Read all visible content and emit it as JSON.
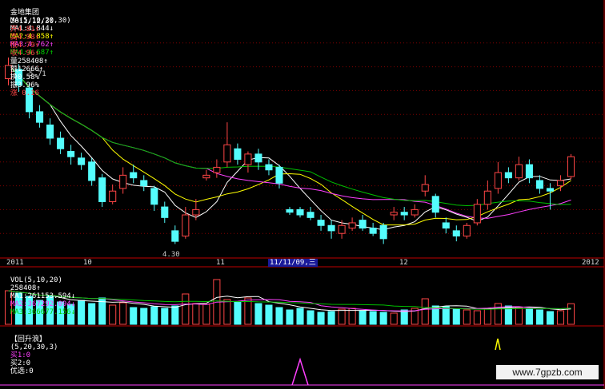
{
  "header": {
    "stock_name": "金地集团",
    "ma_label": "MA(5,10,20,30)",
    "ma1": "MA1:4.844↓",
    "ma2": "MA2:4.858↑",
    "ma3": "MA3:4.762↑",
    "ma4": "MA4:4.687↑",
    "date": "2011/12/30",
    "open": "开4.81↑",
    "high": "高4.98↑",
    "low": "低4.79↑",
    "close": "收4.96↑",
    "volume": "量258408↑",
    "amount": "额12666↑",
    "turnover": "换0.58%",
    "amplitude": "振3.96%",
    "change": "涨 0.16"
  },
  "price_annotations": {
    "high_marker": "5.71",
    "low_marker": "4.30"
  },
  "date_axis": {
    "labels": [
      "2011",
      "10",
      "11",
      "12",
      "2012"
    ],
    "cursor_label": "11/11/09,三"
  },
  "volume_header": {
    "label": "VOL(5,10,20)",
    "value": "258408↑",
    "ma1": "MA1:261153.594↓",
    "ma2": "MA2:367292.094↓",
    "ma3": "MA3:366677.156↓"
  },
  "indicator_header": {
    "name": "【回升浪】",
    "params": "(5,20,30,3)",
    "buy1": "买1:0",
    "buy2": "买2:0",
    "pick": "优选:0"
  },
  "watermark": "www.7gpzb.com",
  "colors": {
    "up": "#ff4646",
    "down": "#54fcfc",
    "ma1": "#ffffff",
    "ma2": "#ffff00",
    "ma3": "#ff40ff",
    "ma4": "#00c000",
    "grid": "#800000",
    "axis": "#c00000"
  },
  "chart_data": {
    "type": "candlestick",
    "title": "金地集团",
    "x_range": [
      "2011-08",
      "2012-01"
    ],
    "y_range": [
      4.2,
      6.0
    ],
    "grid": true,
    "candles": [
      {
        "o": 5.55,
        "c": 5.65,
        "h": 5.71,
        "l": 5.5
      },
      {
        "o": 5.62,
        "c": 5.5,
        "h": 5.66,
        "l": 5.45
      },
      {
        "o": 5.48,
        "c": 5.3,
        "h": 5.52,
        "l": 5.25
      },
      {
        "o": 5.3,
        "c": 5.22,
        "h": 5.35,
        "l": 5.18
      },
      {
        "o": 5.2,
        "c": 5.1,
        "h": 5.25,
        "l": 5.05
      },
      {
        "o": 5.1,
        "c": 5.02,
        "h": 5.15,
        "l": 4.98
      },
      {
        "o": 5.0,
        "c": 4.96,
        "h": 5.05,
        "l": 4.9
      },
      {
        "o": 4.95,
        "c": 4.9,
        "h": 4.99,
        "l": 4.86
      },
      {
        "o": 4.92,
        "c": 4.78,
        "h": 4.95,
        "l": 4.74
      },
      {
        "o": 4.8,
        "c": 4.62,
        "h": 4.83,
        "l": 4.58
      },
      {
        "o": 4.62,
        "c": 4.7,
        "h": 4.75,
        "l": 4.6
      },
      {
        "o": 4.72,
        "c": 4.82,
        "h": 4.88,
        "l": 4.68
      },
      {
        "o": 4.84,
        "c": 4.8,
        "h": 4.9,
        "l": 4.76
      },
      {
        "o": 4.78,
        "c": 4.74,
        "h": 4.82,
        "l": 4.7
      },
      {
        "o": 4.72,
        "c": 4.6,
        "h": 4.74,
        "l": 4.55
      },
      {
        "o": 4.58,
        "c": 4.5,
        "h": 4.62,
        "l": 4.46
      },
      {
        "o": 4.4,
        "c": 4.32,
        "h": 4.44,
        "l": 4.3
      },
      {
        "o": 4.36,
        "c": 4.52,
        "h": 4.58,
        "l": 4.34
      },
      {
        "o": 4.52,
        "c": 4.56,
        "h": 4.64,
        "l": 4.48
      },
      {
        "o": 4.8,
        "c": 4.82,
        "h": 4.86,
        "l": 4.78
      },
      {
        "o": 4.84,
        "c": 4.88,
        "h": 4.94,
        "l": 4.8
      },
      {
        "o": 4.92,
        "c": 5.05,
        "h": 5.22,
        "l": 4.88
      },
      {
        "o": 5.02,
        "c": 4.94,
        "h": 5.06,
        "l": 4.9
      },
      {
        "o": 4.9,
        "c": 4.98,
        "h": 5.0,
        "l": 4.84
      },
      {
        "o": 4.98,
        "c": 4.92,
        "h": 5.02,
        "l": 4.86
      },
      {
        "o": 4.9,
        "c": 4.86,
        "h": 4.94,
        "l": 4.82
      },
      {
        "o": 4.88,
        "c": 4.76,
        "h": 4.9,
        "l": 4.72
      },
      {
        "o": 4.56,
        "c": 4.54,
        "h": 4.58,
        "l": 4.52
      },
      {
        "o": 4.56,
        "c": 4.52,
        "h": 4.58,
        "l": 4.5
      },
      {
        "o": 4.54,
        "c": 4.5,
        "h": 4.58,
        "l": 4.48
      },
      {
        "o": 4.48,
        "c": 4.44,
        "h": 4.52,
        "l": 4.4
      },
      {
        "o": 4.44,
        "c": 4.4,
        "h": 4.48,
        "l": 4.34
      },
      {
        "o": 4.38,
        "c": 4.44,
        "h": 4.48,
        "l": 4.34
      },
      {
        "o": 4.42,
        "c": 4.46,
        "h": 4.5,
        "l": 4.4
      },
      {
        "o": 4.48,
        "c": 4.42,
        "h": 4.52,
        "l": 4.4
      },
      {
        "o": 4.42,
        "c": 4.38,
        "h": 4.46,
        "l": 4.36
      },
      {
        "o": 4.44,
        "c": 4.34,
        "h": 4.46,
        "l": 4.3
      },
      {
        "o": 4.52,
        "c": 4.54,
        "h": 4.58,
        "l": 4.48
      },
      {
        "o": 4.54,
        "c": 4.52,
        "h": 4.58,
        "l": 4.48
      },
      {
        "o": 4.52,
        "c": 4.56,
        "h": 4.6,
        "l": 4.5
      },
      {
        "o": 4.7,
        "c": 4.75,
        "h": 4.82,
        "l": 4.66
      },
      {
        "o": 4.66,
        "c": 4.54,
        "h": 4.68,
        "l": 4.5
      },
      {
        "o": 4.46,
        "c": 4.42,
        "h": 4.5,
        "l": 4.38
      },
      {
        "o": 4.4,
        "c": 4.36,
        "h": 4.44,
        "l": 4.32
      },
      {
        "o": 4.36,
        "c": 4.44,
        "h": 4.46,
        "l": 4.34
      },
      {
        "o": 4.46,
        "c": 4.6,
        "h": 4.64,
        "l": 4.44
      },
      {
        "o": 4.6,
        "c": 4.7,
        "h": 4.78,
        "l": 4.56
      },
      {
        "o": 4.72,
        "c": 4.84,
        "h": 4.92,
        "l": 4.68
      },
      {
        "o": 4.84,
        "c": 4.8,
        "h": 4.88,
        "l": 4.76
      },
      {
        "o": 4.8,
        "c": 4.9,
        "h": 4.96,
        "l": 4.78
      },
      {
        "o": 4.9,
        "c": 4.8,
        "h": 4.94,
        "l": 4.76
      },
      {
        "o": 4.78,
        "c": 4.72,
        "h": 4.82,
        "l": 4.68
      },
      {
        "o": 4.72,
        "c": 4.7,
        "h": 4.76,
        "l": 4.56
      },
      {
        "o": 4.74,
        "c": 4.78,
        "h": 4.82,
        "l": 4.7
      },
      {
        "o": 4.81,
        "c": 4.96,
        "h": 4.98,
        "l": 4.79
      }
    ],
    "volume": {
      "values": [
        420,
        390,
        350,
        300,
        360,
        280,
        250,
        300,
        260,
        330,
        240,
        270,
        210,
        200,
        220,
        200,
        230,
        380,
        260,
        250,
        560,
        310,
        280,
        330,
        260,
        240,
        210,
        180,
        200,
        170,
        150,
        160,
        190,
        200,
        170,
        160,
        150,
        140,
        180,
        200,
        320,
        230,
        220,
        190,
        180,
        170,
        200,
        260,
        230,
        210,
        190,
        180,
        160,
        170,
        258
      ],
      "ylim": [
        0,
        600
      ]
    },
    "indicator": {
      "signals": [
        0,
        0,
        0,
        0,
        0,
        0,
        0,
        0,
        0,
        0,
        0,
        0,
        0,
        0,
        0,
        0,
        0,
        0,
        0,
        0,
        0,
        0,
        0,
        0,
        0,
        0,
        0,
        0,
        1,
        0,
        0,
        0,
        0,
        0,
        0,
        0,
        0,
        0,
        0,
        0,
        0,
        0,
        0,
        0,
        0,
        0,
        0,
        0,
        0,
        0,
        0,
        0,
        0,
        0,
        0
      ],
      "ylim": [
        0,
        1
      ]
    }
  }
}
